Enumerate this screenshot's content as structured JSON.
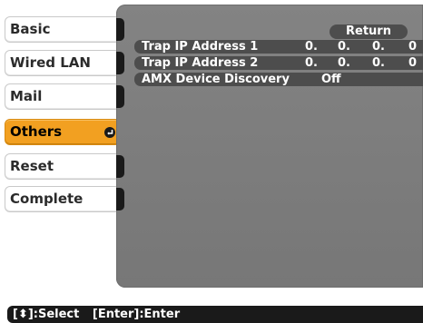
{
  "sidebar": {
    "items": [
      {
        "label": "Basic",
        "selected": false
      },
      {
        "label": "Wired LAN",
        "selected": false
      },
      {
        "label": "Mail",
        "selected": false
      },
      {
        "label": "Others",
        "selected": true,
        "icon": "enter-icon"
      },
      {
        "label": "Reset",
        "selected": false
      },
      {
        "label": "Complete",
        "selected": false
      }
    ]
  },
  "main": {
    "return_label": "Return",
    "rows": [
      {
        "label": "Trap IP Address 1",
        "octets": [
          "0.",
          "0.",
          "0.",
          "0"
        ]
      },
      {
        "label": "Trap IP Address 2",
        "octets": [
          "0.",
          "0.",
          "0.",
          "0"
        ]
      },
      {
        "label": "AMX Device Discovery",
        "value": "Off"
      }
    ]
  },
  "status_bar": {
    "select_hint": "[⬍]:Select",
    "enter_hint": "[Enter]:Enter"
  },
  "colors": {
    "selected_bg": "#f2a021",
    "panel_bg": "#7d7d7d",
    "row_bg": "#4d4d4d",
    "status_bg": "#1a1a1a"
  }
}
